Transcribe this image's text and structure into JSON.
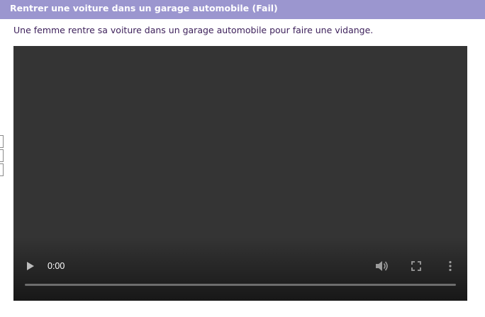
{
  "header": {
    "title": "Rentrer une voiture dans un garage automobile (Fail)"
  },
  "content": {
    "description": "Une femme rentre sa voiture dans un garage automobile pour faire une vidange."
  },
  "video": {
    "time": "0:00",
    "progress": 0,
    "icons": {
      "play": "play-icon",
      "volume": "volume-icon",
      "fullscreen": "fullscreen-icon",
      "more": "more-vertical-icon"
    }
  },
  "colors": {
    "title_bar": "#9b96cf",
    "description_text": "#3c1f5a",
    "video_bg": "#343434"
  }
}
